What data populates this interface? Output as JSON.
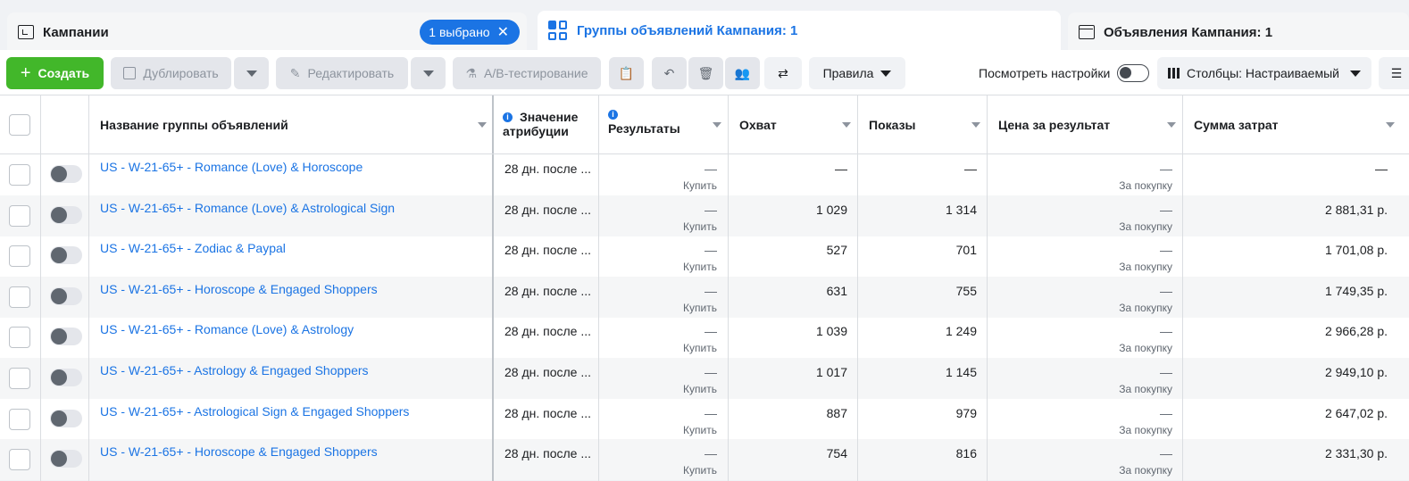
{
  "tabs": {
    "campaigns": {
      "label": "Кампании",
      "badge": "1 выбрано",
      "badge_close": "✕"
    },
    "adsets": {
      "label": "Группы объявлений Кампания: 1"
    },
    "ads": {
      "label": "Объявления Кампания: 1"
    }
  },
  "toolbar": {
    "create": "Создать",
    "duplicate": "Дублировать",
    "edit": "Редактировать",
    "ab_test": "A/B-тестирование",
    "rules": "Правила",
    "view_settings": "Посмотреть настройки",
    "columns": "Столбцы: Настраиваемый"
  },
  "table": {
    "headers": {
      "name": "Название группы объявлений",
      "attribution_line1": "Значение",
      "attribution_line2": "атрибуции",
      "results": "Результаты",
      "reach": "Охват",
      "impressions": "Показы",
      "cost_per_result": "Цена за результат",
      "amount_spent": "Сумма затрат"
    },
    "rows": [
      {
        "name": "US - W-21-65+ - Romance (Love) & Horoscope",
        "attribution": "28 дн. после ...",
        "results": "—",
        "results_sub": "Купить",
        "reach": "—",
        "impressions": "—",
        "cost": "—",
        "cost_sub": "За покупку",
        "spent": "—"
      },
      {
        "name": "US - W-21-65+ - Romance (Love) & Astrological Sign",
        "attribution": "28 дн. после ...",
        "results": "—",
        "results_sub": "Купить",
        "reach": "1 029",
        "impressions": "1 314",
        "cost": "—",
        "cost_sub": "За покупку",
        "spent": "2 881,31 р."
      },
      {
        "name": "US - W-21-65+ - Zodiac & Paypal",
        "attribution": "28 дн. после ...",
        "results": "—",
        "results_sub": "Купить",
        "reach": "527",
        "impressions": "701",
        "cost": "—",
        "cost_sub": "За покупку",
        "spent": "1 701,08 р."
      },
      {
        "name": "US - W-21-65+ - Horoscope & Engaged Shoppers",
        "attribution": "28 дн. после ...",
        "results": "—",
        "results_sub": "Купить",
        "reach": "631",
        "impressions": "755",
        "cost": "—",
        "cost_sub": "За покупку",
        "spent": "1 749,35 р."
      },
      {
        "name": "US - W-21-65+ - Romance (Love) & Astrology",
        "attribution": "28 дн. после ...",
        "results": "—",
        "results_sub": "Купить",
        "reach": "1 039",
        "impressions": "1 249",
        "cost": "—",
        "cost_sub": "За покупку",
        "spent": "2 966,28 р."
      },
      {
        "name": "US - W-21-65+ - Astrology & Engaged Shoppers",
        "attribution": "28 дн. после ...",
        "results": "—",
        "results_sub": "Купить",
        "reach": "1 017",
        "impressions": "1 145",
        "cost": "—",
        "cost_sub": "За покупку",
        "spent": "2 949,10 р."
      },
      {
        "name": "US - W-21-65+ - Astrological Sign & Engaged Shoppers",
        "attribution": "28 дн. после ...",
        "results": "—",
        "results_sub": "Купить",
        "reach": "887",
        "impressions": "979",
        "cost": "—",
        "cost_sub": "За покупку",
        "spent": "2 647,02 р."
      },
      {
        "name": "US - W-21-65+ - Horoscope & Engaged Shoppers",
        "attribution": "28 дн. после ...",
        "results": "—",
        "results_sub": "Купить",
        "reach": "754",
        "impressions": "816",
        "cost": "—",
        "cost_sub": "За покупку",
        "spent": "2 331,30 р."
      }
    ]
  }
}
